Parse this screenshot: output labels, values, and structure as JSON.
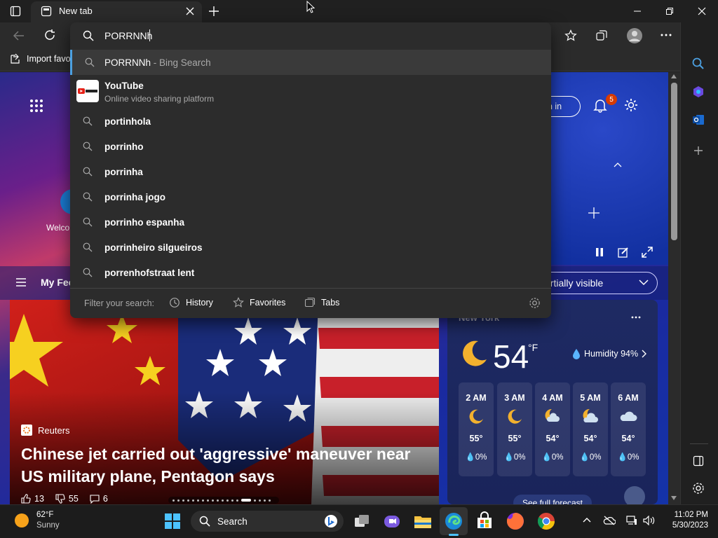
{
  "browser": {
    "tab_title": "New tab",
    "import_favorites_label": "Import favo"
  },
  "address_bar": {
    "value": "PORRNNh"
  },
  "suggestions": {
    "first": {
      "query": "PORRNNh",
      "suffix": "- Bing Search"
    },
    "site": {
      "title": "YouTube",
      "subtitle": "Online video sharing platform"
    },
    "items": [
      "portinhola",
      "porrinho",
      "porrinha",
      "porrinha jogo",
      "porrinho espanha",
      "porrinheiro silgueiros",
      "porrenhofstraat lent"
    ],
    "filter_label": "Filter your search:",
    "filters": [
      "History",
      "Favorites",
      "Tabs"
    ]
  },
  "page": {
    "sign_in": "gn in",
    "notifications_count": "5",
    "welcome_label": "Welco",
    "feed_label": "My Fee",
    "layout_select": "artially visible",
    "news": {
      "source": "Reuters",
      "title": "Chinese jet carried out 'aggressive' maneuver near US military plane, Pentagon says",
      "likes": "13",
      "dislikes": "55",
      "comments": "6"
    },
    "weather": {
      "location": "New York",
      "temp": "54",
      "unit": "°F",
      "humidity": "Humidity 94%",
      "hours": [
        {
          "time": "2 AM",
          "temp": "55°",
          "precip": "0%",
          "icon": "moon"
        },
        {
          "time": "3 AM",
          "temp": "55°",
          "precip": "0%",
          "icon": "moon"
        },
        {
          "time": "4 AM",
          "temp": "54°",
          "precip": "0%",
          "icon": "moon-cloud"
        },
        {
          "time": "5 AM",
          "temp": "54°",
          "precip": "0%",
          "icon": "moon-cloud"
        },
        {
          "time": "6 AM",
          "temp": "54°",
          "precip": "0%",
          "icon": "cloud"
        }
      ],
      "see_forecast": "See full forecast"
    }
  },
  "taskbar": {
    "weather_temp": "62°F",
    "weather_desc": "Sunny",
    "search_label": "Search",
    "time": "11:02 PM",
    "date": "5/30/2023"
  },
  "colors": {
    "accent": "#4ca0e0",
    "dropdown_bg": "#2c2c2c",
    "chrome_bg": "#202020"
  }
}
